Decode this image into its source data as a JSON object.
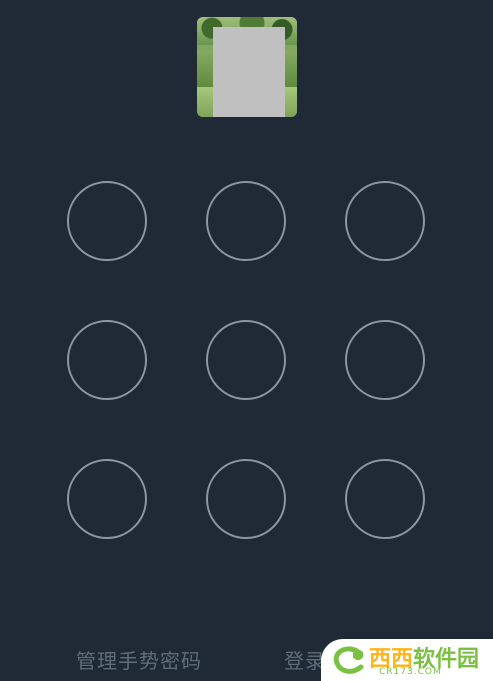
{
  "user": {
    "avatar_icon": "user-avatar-photo"
  },
  "pattern": {
    "rows": 3,
    "cols": 3,
    "stroke_color": "#8c97a3",
    "background_color": "#1f2a36"
  },
  "footer": {
    "manage_label": "管理手势密码",
    "login_label": "登录"
  },
  "watermark": {
    "brand_main": "西西",
    "brand_secondary": "软件园",
    "brand_sub": "CR173.COM"
  }
}
